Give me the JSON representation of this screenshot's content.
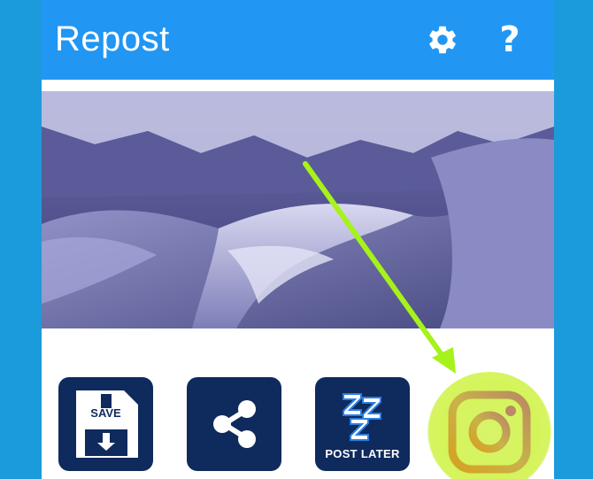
{
  "app_bar": {
    "title": "Repost",
    "background": "#2196f3",
    "icons": [
      "gear-icon",
      "help-icon"
    ],
    "help_glyph": "?"
  },
  "photo": {
    "subject": "snow-covered mountain ridges"
  },
  "actions": {
    "save_label": "SAVE",
    "post_later_label": "POST LATER",
    "zz_glyph": "ZZZ",
    "icons": [
      "floppy-disk-icon",
      "share-icon",
      "sleep-zzz-icon",
      "instagram-icon"
    ]
  },
  "highlight": {
    "arrow_color": "#a6f21a",
    "glow_color": "#d4f45a"
  }
}
